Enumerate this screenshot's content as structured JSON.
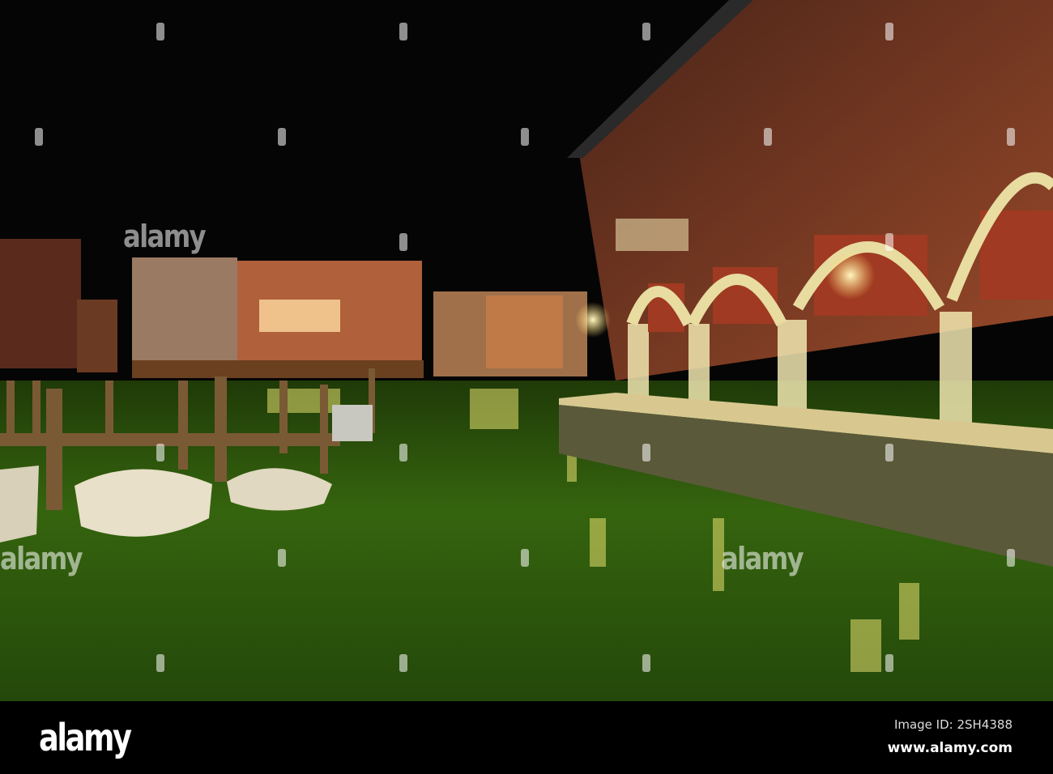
{
  "watermark": {
    "text": "alamy"
  },
  "footer": {
    "logo": "alamy",
    "image_id": "Image ID: 2SH4388",
    "url": "www.alamy.com"
  },
  "colors": {
    "sky": "#050505",
    "water": "#2f5a0c",
    "brick": "#8a3f25",
    "light": "#ffd56a"
  }
}
